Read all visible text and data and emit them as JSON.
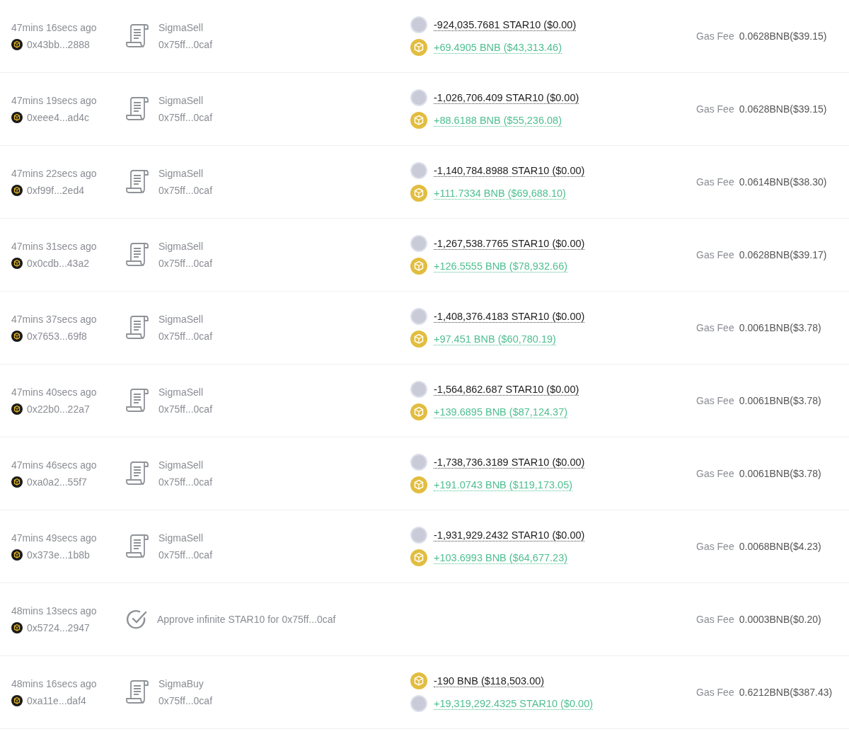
{
  "transactions": [
    {
      "time": "47mins 16secs ago",
      "sender": "0x43bb...2888",
      "kind": "contract",
      "method": "SigmaSell",
      "contract": "0x75ff...0caf",
      "transfers": [
        {
          "kind": "star10",
          "incoming": false,
          "text": "-924,035.7681 STAR10 ($0.00)"
        },
        {
          "kind": "bnb",
          "incoming": true,
          "text": "+69.4905 BNB ($43,313.46)"
        }
      ],
      "gas_label": "Gas Fee",
      "gas": "0.0628BNB($39.15)"
    },
    {
      "time": "47mins 19secs ago",
      "sender": "0xeee4...ad4c",
      "kind": "contract",
      "method": "SigmaSell",
      "contract": "0x75ff...0caf",
      "transfers": [
        {
          "kind": "star10",
          "incoming": false,
          "text": "-1,026,706.409 STAR10 ($0.00)"
        },
        {
          "kind": "bnb",
          "incoming": true,
          "text": "+88.6188 BNB ($55,236.08)"
        }
      ],
      "gas_label": "Gas Fee",
      "gas": "0.0628BNB($39.15)"
    },
    {
      "time": "47mins 22secs ago",
      "sender": "0xf99f...2ed4",
      "kind": "contract",
      "method": "SigmaSell",
      "contract": "0x75ff...0caf",
      "transfers": [
        {
          "kind": "star10",
          "incoming": false,
          "text": "-1,140,784.8988 STAR10 ($0.00)"
        },
        {
          "kind": "bnb",
          "incoming": true,
          "text": "+111.7334 BNB ($69,688.10)"
        }
      ],
      "gas_label": "Gas Fee",
      "gas": "0.0614BNB($38.30)"
    },
    {
      "time": "47mins 31secs ago",
      "sender": "0x0cdb...43a2",
      "kind": "contract",
      "method": "SigmaSell",
      "contract": "0x75ff...0caf",
      "transfers": [
        {
          "kind": "star10",
          "incoming": false,
          "text": "-1,267,538.7765 STAR10 ($0.00)"
        },
        {
          "kind": "bnb",
          "incoming": true,
          "text": "+126.5555 BNB ($78,932.66)"
        }
      ],
      "gas_label": "Gas Fee",
      "gas": "0.0628BNB($39.17)"
    },
    {
      "time": "47mins 37secs ago",
      "sender": "0x7653...69f8",
      "kind": "contract",
      "method": "SigmaSell",
      "contract": "0x75ff...0caf",
      "transfers": [
        {
          "kind": "star10",
          "incoming": false,
          "text": "-1,408,376.4183 STAR10 ($0.00)"
        },
        {
          "kind": "bnb",
          "incoming": true,
          "text": "+97.451 BNB ($60,780.19)"
        }
      ],
      "gas_label": "Gas Fee",
      "gas": "0.0061BNB($3.78)"
    },
    {
      "time": "47mins 40secs ago",
      "sender": "0x22b0...22a7",
      "kind": "contract",
      "method": "SigmaSell",
      "contract": "0x75ff...0caf",
      "transfers": [
        {
          "kind": "star10",
          "incoming": false,
          "text": "-1,564,862.687 STAR10 ($0.00)"
        },
        {
          "kind": "bnb",
          "incoming": true,
          "text": "+139.6895 BNB ($87,124.37)"
        }
      ],
      "gas_label": "Gas Fee",
      "gas": "0.0061BNB($3.78)"
    },
    {
      "time": "47mins 46secs ago",
      "sender": "0xa0a2...55f7",
      "kind": "contract",
      "method": "SigmaSell",
      "contract": "0x75ff...0caf",
      "transfers": [
        {
          "kind": "star10",
          "incoming": false,
          "text": "-1,738,736.3189 STAR10 ($0.00)"
        },
        {
          "kind": "bnb",
          "incoming": true,
          "text": "+191.0743 BNB ($119,173.05)"
        }
      ],
      "gas_label": "Gas Fee",
      "gas": "0.0061BNB($3.78)"
    },
    {
      "time": "47mins 49secs ago",
      "sender": "0x373e...1b8b",
      "kind": "contract",
      "method": "SigmaSell",
      "contract": "0x75ff...0caf",
      "transfers": [
        {
          "kind": "star10",
          "incoming": false,
          "text": "-1,931,929.2432 STAR10 ($0.00)"
        },
        {
          "kind": "bnb",
          "incoming": true,
          "text": "+103.6993 BNB ($64,677.23)"
        }
      ],
      "gas_label": "Gas Fee",
      "gas": "0.0068BNB($4.23)"
    },
    {
      "time": "48mins 13secs ago",
      "sender": "0x5724...2947",
      "kind": "approve",
      "description": "Approve infinite STAR10 for 0x75ff...0caf",
      "gas_label": "Gas Fee",
      "gas": "0.0003BNB($0.20)"
    },
    {
      "time": "48mins 16secs ago",
      "sender": "0xa11e...daf4",
      "kind": "contract",
      "method": "SigmaBuy",
      "contract": "0x75ff...0caf",
      "transfers": [
        {
          "kind": "bnb",
          "incoming": false,
          "text": "-190 BNB ($118,503.00)"
        },
        {
          "kind": "star10",
          "incoming": true,
          "text": "+19,319,292.4325 STAR10 ($0.00)"
        }
      ],
      "gas_label": "Gas Fee",
      "gas": "0.6212BNB($387.43)"
    }
  ]
}
